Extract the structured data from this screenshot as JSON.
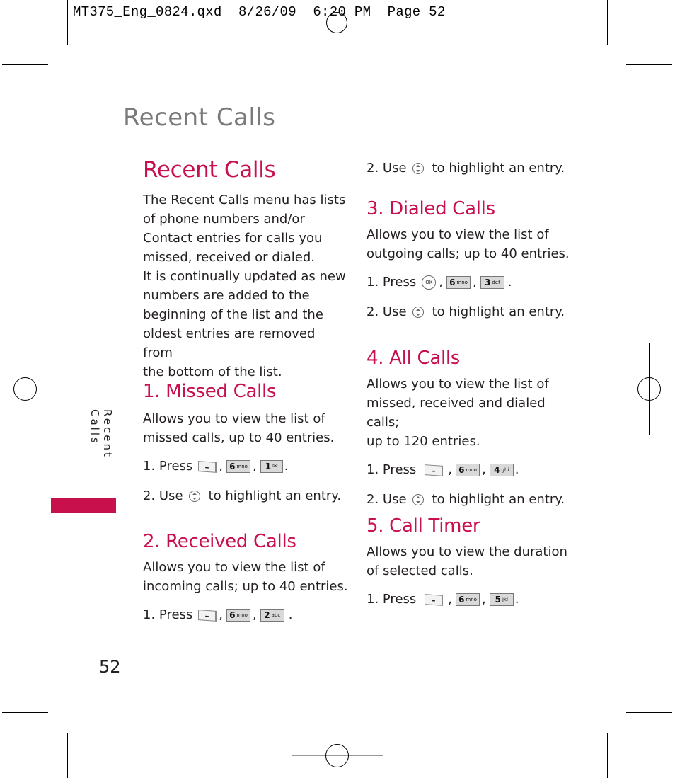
{
  "slug": "MT375_Eng_0824.qxd  8/26/09  6:20 PM  Page 52",
  "chapter_title": "Recent Calls",
  "side_tab_label": "Recent Calls",
  "page_number": "52",
  "colors": {
    "accent": "#c8104d",
    "chapter_gray": "#7a7a7a",
    "text": "#231f20"
  },
  "intro": {
    "heading": "Recent Calls",
    "lines": [
      "The Recent Calls menu has lists",
      "of phone numbers and/or",
      "Contact entries for calls you",
      "missed, received or dialed.",
      "It is continually updated as new",
      "numbers are added to the",
      "beginning of the list and the",
      "oldest entries are removed from",
      "the bottom of the list."
    ]
  },
  "sections": [
    {
      "heading": "1. Missed Calls",
      "desc": [
        "Allows you to view the list of",
        "missed calls, up to 40 entries."
      ],
      "step1": {
        "label": "1. Press",
        "keys": [
          {
            "type": "softkey",
            "icon": "left-softkey-icon",
            "text": "–"
          },
          {
            "type": "key",
            "num": "6",
            "letters": "mno"
          },
          {
            "type": "key",
            "num": "1",
            "letters": "voicemail-icon"
          }
        ]
      },
      "step2": {
        "label": "2. Use",
        "after": "to highlight an entry."
      }
    },
    {
      "heading": "2. Received Calls",
      "desc": [
        "Allows you to view the list of",
        "incoming calls; up to 40 entries."
      ],
      "step1": {
        "label": "1. Press",
        "keys": [
          {
            "type": "softkey",
            "icon": "left-softkey-icon",
            "text": "–"
          },
          {
            "type": "key",
            "num": "6",
            "letters": "mno"
          },
          {
            "type": "key",
            "num": "2",
            "letters": "abc"
          }
        ]
      }
    },
    {
      "heading": "3. Dialed Calls",
      "desc": [
        "Allows you to view the list of",
        "outgoing calls; up to 40 entries."
      ],
      "step1": {
        "label": "1. Press",
        "keys": [
          {
            "type": "ok",
            "text": "OK"
          },
          {
            "type": "key",
            "num": "6",
            "letters": "mno"
          },
          {
            "type": "key",
            "num": "3",
            "letters": "def"
          }
        ]
      },
      "step2": {
        "label": "2.  Use",
        "after": "to highlight an entry."
      }
    },
    {
      "heading": "4. All Calls",
      "desc": [
        "Allows you to view the list of",
        "missed, received and dialed calls;",
        "up to 120 entries."
      ],
      "step1": {
        "label": "1. Press",
        "keys": [
          {
            "type": "softkey",
            "icon": "left-softkey-icon",
            "text": "–"
          },
          {
            "type": "key",
            "num": "6",
            "letters": "mno"
          },
          {
            "type": "key",
            "num": "4",
            "letters": "ghi"
          }
        ]
      },
      "step2": {
        "label": "2. Use",
        "after": "to highlight an entry."
      }
    },
    {
      "heading": "5. Call Timer",
      "desc": [
        "Allows you to view the duration",
        "of selected calls."
      ],
      "step1": {
        "label": "1. Press",
        "keys": [
          {
            "type": "softkey",
            "icon": "left-softkey-icon",
            "text": "–"
          },
          {
            "type": "key",
            "num": "6",
            "letters": "mno"
          },
          {
            "type": "key",
            "num": "5",
            "letters": "jkl"
          }
        ]
      }
    }
  ],
  "received_step2_col2": {
    "label": "2. Use",
    "after": "to highlight an entry."
  },
  "punct": {
    "comma": ",",
    "period": "."
  }
}
